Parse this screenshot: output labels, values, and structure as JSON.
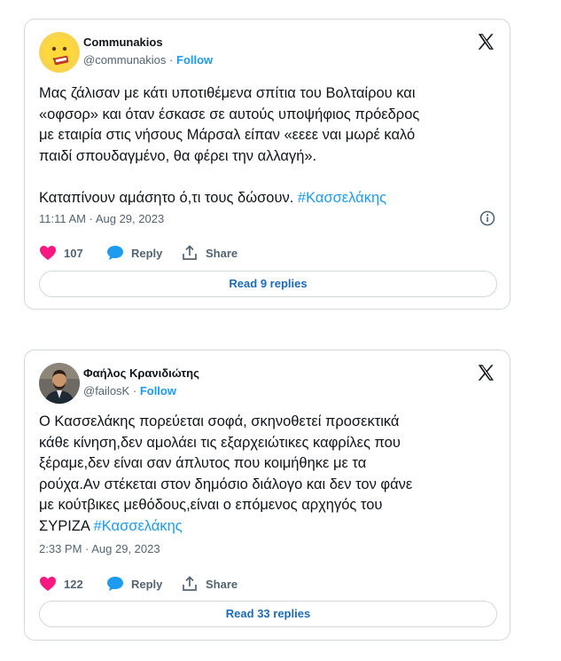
{
  "tweets": [
    {
      "author_name": "Communakios",
      "handle": "@communakios",
      "separator": "·",
      "follow_label": "Follow",
      "text_lines": [
        "Μας ζάλισαν με κάτι υποτιθέμενα σπίτια του Βολταίρου και",
        "«οφσορ» και όταν έσκασε σε αυτούς υποψήφιος πρόεδρος",
        "με εταιρία στις νήσους Μάρσαλ είπαν «εεεε ναι μωρέ καλό",
        "παιδί σπουδαγμένο, θα φέρει την αλλαγή»."
      ],
      "text_last_plain": "Καταπίνουν αμάσητο ό,τι τους δώσουν. ",
      "hashtag": "#Κασσελάκης",
      "timestamp": "11:11 AM · Aug 29, 2023",
      "likes": "107",
      "reply_label": "Reply",
      "share_label": "Share",
      "read_replies": "Read 9 replies"
    },
    {
      "author_name": "Φαήλος Κρανιδιώτης",
      "handle": "@failosK",
      "separator": "·",
      "follow_label": "Follow",
      "text_lines": [
        "Ο Κασσελάκης πορεύεται σοφά, σκηνοθετεί προσεκτικά",
        "κάθε κίνηση,δεν αμολάει τις εξαρχειώτικες καφρίλες που",
        "ξέραμε,δεν είναι σαν άπλυτος που κοιμήθηκε με τα",
        "ρούχα.Αν στέκεται στον δημόσιο διάλογο και δεν τον φάνε",
        "με κούτβικες μεθόδους,είναι ο επόμενος αρχηγός του"
      ],
      "text_last_plain": "ΣΥΡΙΖΑ ",
      "hashtag": "#Κασσελάκης",
      "timestamp": "2:33 PM · Aug 29, 2023",
      "likes": "122",
      "reply_label": "Reply",
      "share_label": "Share",
      "read_replies": "Read 33 replies"
    }
  ],
  "icons": {
    "logo": "x-logo-icon",
    "info": "info-icon",
    "like": "heart-icon",
    "reply": "speech-bubble-icon",
    "share": "share-icon"
  },
  "colors": {
    "accent": "#1d9bf0",
    "like": "#f91880",
    "text": "#0f1419",
    "muted": "#536471",
    "border": "#cfd9de"
  }
}
